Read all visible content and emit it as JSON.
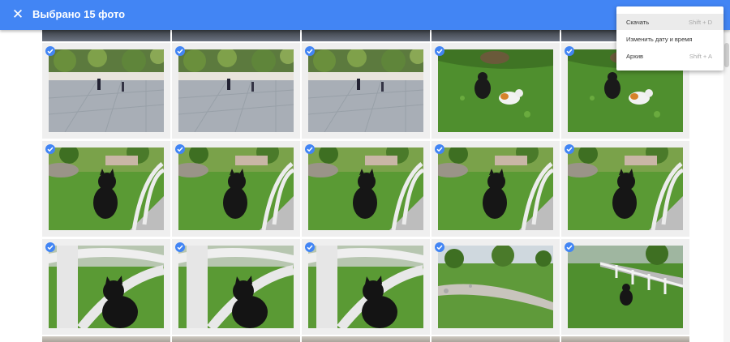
{
  "header": {
    "close_icon": "close-icon",
    "title": "Выбрано 15 фото",
    "accent_color": "#4285f4"
  },
  "menu": {
    "items": [
      {
        "label": "Скачать",
        "shortcut": "Shift + D"
      },
      {
        "label": "Изменить дату и время",
        "shortcut": ""
      },
      {
        "label": "Архив",
        "shortcut": "Shift + A"
      }
    ]
  },
  "photos": [
    {
      "scene": "plaza",
      "selected": true
    },
    {
      "scene": "plaza",
      "selected": true
    },
    {
      "scene": "plaza",
      "selected": true
    },
    {
      "scene": "cats-grass",
      "selected": true
    },
    {
      "scene": "cats-grass",
      "selected": true
    },
    {
      "scene": "cat-fence",
      "selected": true
    },
    {
      "scene": "cat-fence",
      "selected": true
    },
    {
      "scene": "cat-fence",
      "selected": true
    },
    {
      "scene": "cat-fence",
      "selected": true
    },
    {
      "scene": "cat-fence",
      "selected": true
    },
    {
      "scene": "cat-closeup",
      "selected": true
    },
    {
      "scene": "cat-closeup",
      "selected": true
    },
    {
      "scene": "cat-closeup",
      "selected": true
    },
    {
      "scene": "park",
      "selected": true
    },
    {
      "scene": "park-fence",
      "selected": true
    }
  ]
}
